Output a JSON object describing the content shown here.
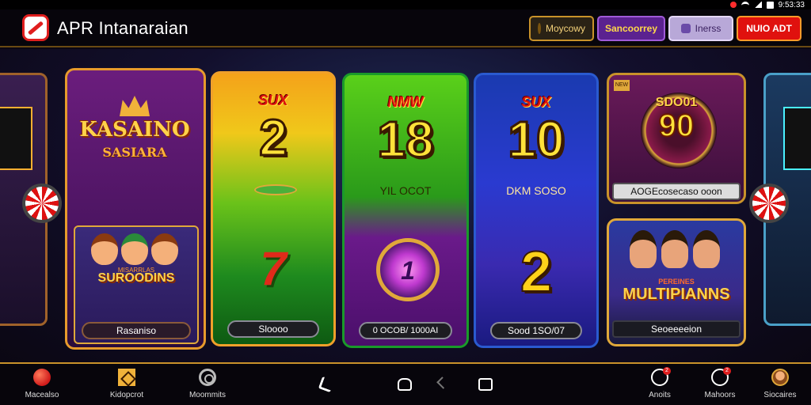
{
  "status_bar": {
    "time": "9:53:33"
  },
  "app_bar": {
    "title": "APR Intanaraian",
    "buttons": {
      "money": "Moycowy",
      "sound": "Sancoorrey",
      "there": "Inerss",
      "auto": "NUIO ADT"
    }
  },
  "cards": [
    {
      "title": "KASAINO",
      "subtitle": "SASIARA",
      "inner_kicker": "MISARRLAS",
      "inner_title": "SUROODINS",
      "label": "Rasaniso"
    },
    {
      "tag": "SUX",
      "number": "2",
      "label": "Sloooo"
    },
    {
      "tag": "NMW",
      "number": "18",
      "caption": "YIL OCOT",
      "medal_number": "1",
      "label": "0 OCOB/ 1000AI"
    },
    {
      "tag": "SUX",
      "number": "10",
      "caption": "DKM SOSO",
      "second_number": "2",
      "label": "Sood 1SO/07"
    },
    {
      "disk_title": "SDO01",
      "disk_number": "90",
      "corner": "NEW",
      "label": "AOGEcosecaso ooon"
    },
    {
      "kicker": "PEREINES",
      "title": "MULTIPIANNS",
      "label": "Seoeeeeion"
    }
  ],
  "bottom_nav": {
    "items": [
      {
        "label": "Macealso"
      },
      {
        "label": "Kidopcrot"
      },
      {
        "label": "Moommits"
      },
      {
        "label": "Anoits",
        "badge": "2"
      },
      {
        "label": "Mahoors",
        "badge": "2"
      },
      {
        "label": "Siocaires"
      }
    ]
  },
  "colors": {
    "accent_gold": "#c9922a",
    "auto_red": "#e0110e",
    "sound_purple": "#5b2290"
  }
}
